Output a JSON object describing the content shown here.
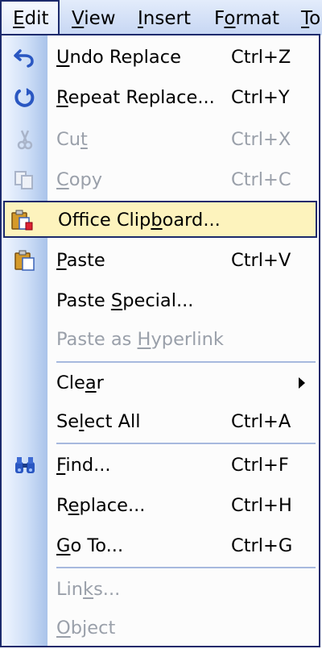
{
  "menubar": {
    "items": [
      {
        "label_pre": "",
        "accel": "E",
        "label_post": "dit"
      },
      {
        "label_pre": "",
        "accel": "V",
        "label_post": "iew"
      },
      {
        "label_pre": "",
        "accel": "I",
        "label_post": "nsert"
      },
      {
        "label_pre": "F",
        "accel": "o",
        "label_post": "rmat"
      },
      {
        "label_pre": "",
        "accel": "T",
        "label_post": "o"
      }
    ]
  },
  "menu": {
    "items": [
      {
        "pre": "",
        "accel": "U",
        "post": "ndo Replace",
        "shortcut": "Ctrl+Z"
      },
      {
        "pre": "",
        "accel": "R",
        "post": "epeat Replace...",
        "shortcut": "Ctrl+Y"
      },
      {
        "pre": "Cu",
        "accel": "t",
        "post": "",
        "shortcut": "Ctrl+X"
      },
      {
        "pre": "",
        "accel": "C",
        "post": "opy",
        "shortcut": "Ctrl+C"
      },
      {
        "pre": "Office Clip",
        "accel": "b",
        "post": "oard...",
        "shortcut": ""
      },
      {
        "pre": "",
        "accel": "P",
        "post": "aste",
        "shortcut": "Ctrl+V"
      },
      {
        "pre": "Paste ",
        "accel": "S",
        "post": "pecial...",
        "shortcut": ""
      },
      {
        "pre": "Paste as ",
        "accel": "H",
        "post": "yperlink",
        "shortcut": ""
      },
      {
        "pre": "Cle",
        "accel": "a",
        "post": "r",
        "shortcut": ""
      },
      {
        "pre": "Se",
        "accel": "l",
        "post": "ect All",
        "shortcut": "Ctrl+A"
      },
      {
        "pre": "",
        "accel": "F",
        "post": "ind...",
        "shortcut": "Ctrl+F"
      },
      {
        "pre": "R",
        "accel": "e",
        "post": "place...",
        "shortcut": "Ctrl+H"
      },
      {
        "pre": "",
        "accel": "G",
        "post": "o To...",
        "shortcut": "Ctrl+G"
      },
      {
        "pre": "Lin",
        "accel": "k",
        "post": "s...",
        "shortcut": ""
      },
      {
        "pre": "",
        "accel": "O",
        "post": "bject",
        "shortcut": ""
      }
    ],
    "submenu_arrow": "▶",
    "icons": [
      "undo-icon",
      "repeat-icon",
      "cut-icon",
      "copy-icon",
      "office-clipboard-icon",
      "paste-icon",
      "find-icon"
    ],
    "colors": {
      "border": "#1c2a6c",
      "highlight": "#fdf3bd",
      "disabled_text": "#9aa0aa"
    }
  }
}
